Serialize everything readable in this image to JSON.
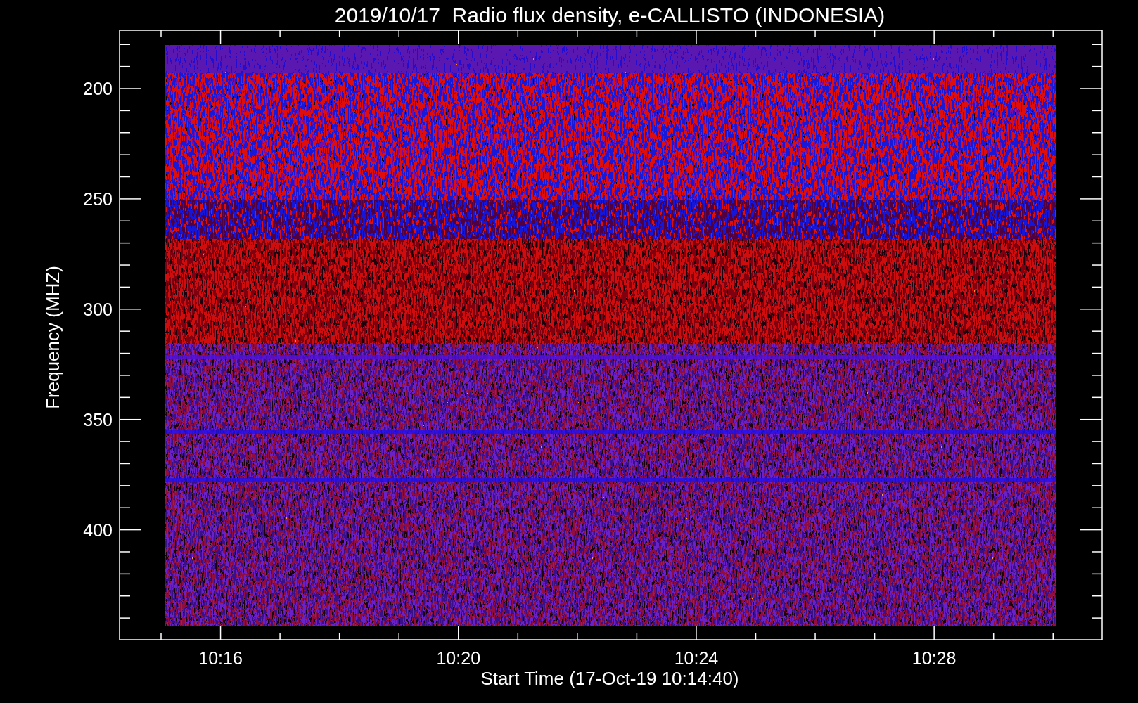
{
  "title": "2019/10/17  Radio flux density, e-CALLISTO (INDONESIA)",
  "y_axis": {
    "label": "Frequency (MHZ)",
    "ticks": [
      "200",
      "250",
      "300",
      "350",
      "400"
    ]
  },
  "x_axis": {
    "label": "Start Time (17-Oct-19 10:14:40)",
    "ticks": [
      "10:16",
      "10:20",
      "10:24",
      "10:28"
    ]
  }
}
